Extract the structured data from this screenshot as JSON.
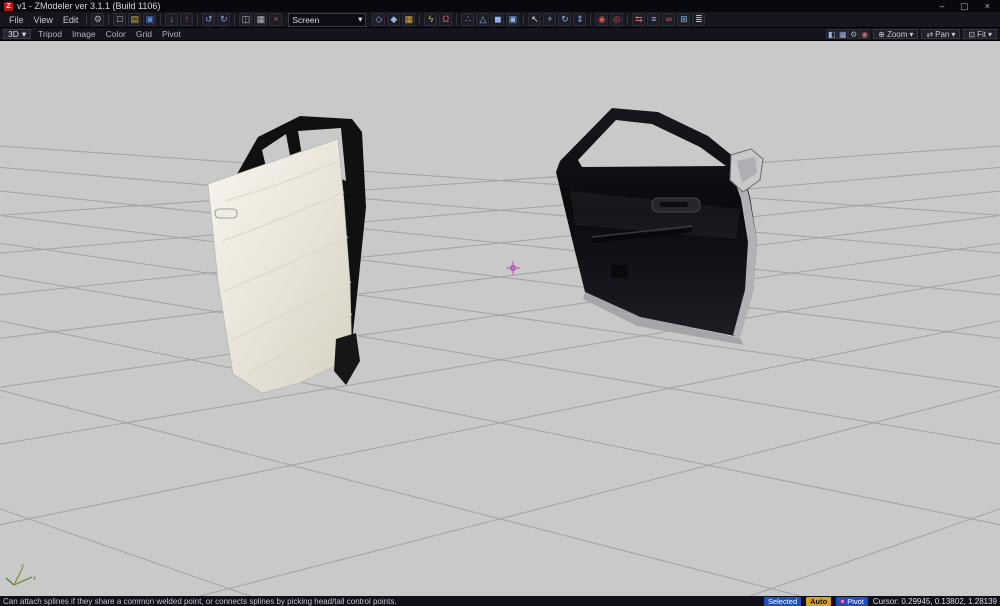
{
  "window": {
    "title": "v1 - ZModeler ver 3.1.1 (Build 1106)",
    "logo_letter": "Z",
    "controls": {
      "minimize": "–",
      "maximize": "▢",
      "close": "×"
    }
  },
  "ui": {
    "chevron": "▾"
  },
  "menubar": {
    "items": [
      "File",
      "View",
      "Edit"
    ]
  },
  "toolbar": {
    "screen_dropdown": {
      "value": "Screen"
    },
    "groups_before": [
      [
        {
          "name": "options",
          "glyph": "⚙",
          "color": "#a8aab8"
        }
      ],
      [
        {
          "name": "new-file",
          "glyph": "□",
          "color": "#e0e0e8"
        },
        {
          "name": "open-folder",
          "glyph": "▤",
          "color": "#d8b23a"
        },
        {
          "name": "save",
          "glyph": "▣",
          "color": "#5585d8"
        }
      ],
      [
        {
          "name": "import",
          "glyph": "↓",
          "color": "#58b858"
        },
        {
          "name": "export",
          "glyph": "↑",
          "color": "#d05858"
        }
      ],
      [
        {
          "name": "undo",
          "glyph": "↺",
          "color": "#84a8e0"
        },
        {
          "name": "redo",
          "glyph": "↻",
          "color": "#84a8e0"
        }
      ],
      [
        {
          "name": "copy",
          "glyph": "◫",
          "color": "#b8bac4"
        },
        {
          "name": "paste",
          "glyph": "▦",
          "color": "#b8bac4"
        },
        {
          "name": "delete",
          "glyph": "×",
          "color": "#d05050"
        }
      ]
    ],
    "groups_after": [
      [
        {
          "name": "wireframe-mode",
          "glyph": "◇",
          "color": "#9ab4dc"
        },
        {
          "name": "shaded-mode",
          "glyph": "◆",
          "color": "#9ab4dc"
        },
        {
          "name": "textured-mode",
          "glyph": "▦",
          "color": "#d8a83a"
        }
      ],
      [
        {
          "name": "light-toggle",
          "glyph": "ϟ",
          "color": "#e0cc3a"
        },
        {
          "name": "magnet-snap",
          "glyph": "Ω",
          "color": "#d06060"
        }
      ],
      [
        {
          "name": "vertices-level",
          "glyph": "∴",
          "color": "#8fb4e8"
        },
        {
          "name": "edges-level",
          "glyph": "△",
          "color": "#8fb4e8"
        },
        {
          "name": "polygons-level",
          "glyph": "◼",
          "color": "#8fb4e8"
        },
        {
          "name": "objects-level",
          "glyph": "▣",
          "color": "#8fb4e8"
        }
      ],
      [
        {
          "name": "select-tool",
          "glyph": "↖",
          "color": "#e0e0e8"
        },
        {
          "name": "move-tool",
          "glyph": "+",
          "color": "#8fb4e8"
        },
        {
          "name": "rotate-tool",
          "glyph": "↻",
          "color": "#8fb4e8"
        },
        {
          "name": "scale-tool",
          "glyph": "⇕",
          "color": "#8fb4e8"
        }
      ],
      [
        {
          "name": "weld-tool",
          "glyph": "◉",
          "color": "#d05858"
        },
        {
          "name": "detach-tool",
          "glyph": "◎",
          "color": "#d05858"
        }
      ],
      [
        {
          "name": "mirror-tool",
          "glyph": "⇆",
          "color": "#c86868"
        },
        {
          "name": "array-tool",
          "glyph": "≡",
          "color": "#8fb4e8"
        },
        {
          "name": "attach-tool",
          "glyph": "∞",
          "color": "#c86868"
        },
        {
          "name": "uv-mapper",
          "glyph": "⊞",
          "color": "#8fb4e8"
        },
        {
          "name": "layers",
          "glyph": "≣",
          "color": "#b8bac4"
        }
      ]
    ]
  },
  "viewport_bar": {
    "view_label": "3D",
    "menus": [
      "Tripod",
      "Image",
      "Color",
      "Grid",
      "Pivot"
    ],
    "icons": [
      {
        "name": "view-mode",
        "glyph": "◧",
        "color": "#9ab4dc"
      },
      {
        "name": "grid-toggle",
        "glyph": "▦",
        "color": "#9ab4dc"
      },
      {
        "name": "viewport-settings",
        "glyph": "⚙",
        "color": "#a8aab8"
      },
      {
        "name": "render-target",
        "glyph": "◉",
        "color": "#c86868"
      }
    ],
    "controls": [
      {
        "label": "Zoom",
        "glyph": "⊕"
      },
      {
        "label": "Pan",
        "glyph": "⇄"
      },
      {
        "label": "Fit",
        "glyph": "⊡"
      }
    ]
  },
  "scene": {
    "background": "#c9c9c9",
    "grid_color": "#a2a2a2",
    "pivot_color": "#b44fb4",
    "objects": [
      "rear door (white, open)",
      "front door (black, open)"
    ]
  },
  "statusbar": {
    "hint": "Can attach splines if they share a common welded point, or connects splines by picking head/tail control points.",
    "badges": {
      "selected": "Selected",
      "auto": "Auto",
      "pivot": "Pivot"
    },
    "cursor": "Cursor: 0.29945, 0.13802, 1.28139"
  }
}
